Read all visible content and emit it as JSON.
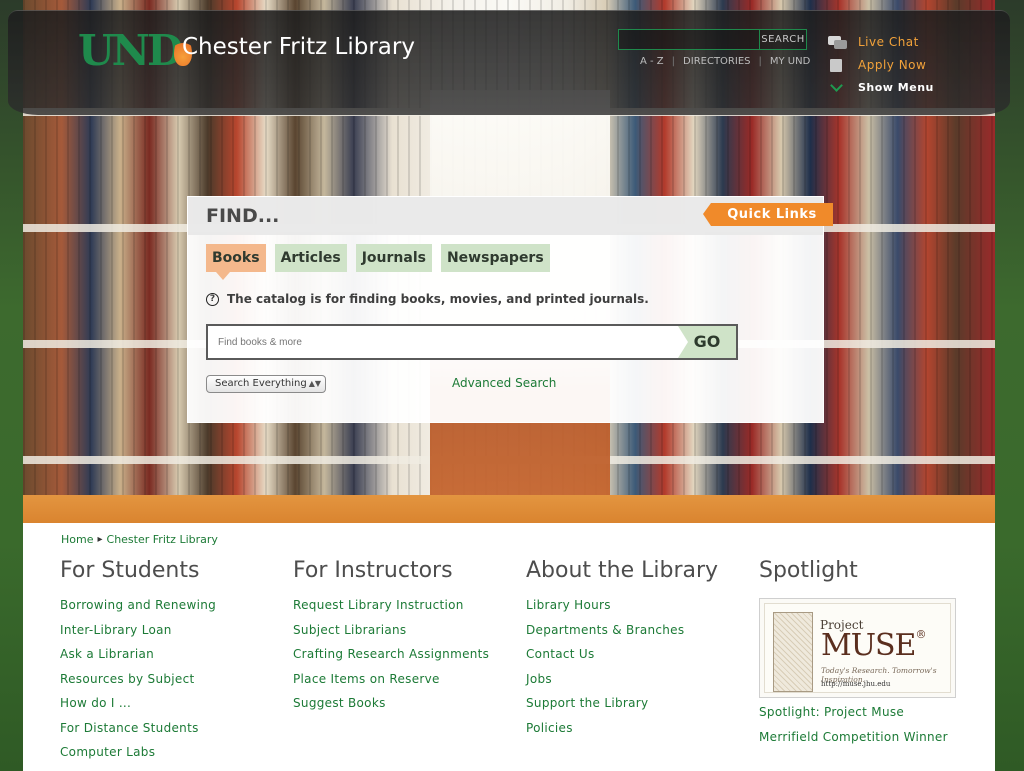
{
  "header": {
    "logo_text": "UND",
    "site_name": "Chester Fritz Library",
    "search": {
      "placeholder": "",
      "button": "SEARCH"
    },
    "utility_links": [
      "A - Z",
      "DIRECTORIES",
      "MY UND"
    ],
    "side_links": [
      {
        "label": "Live Chat",
        "icon": "chat-icon"
      },
      {
        "label": "Apply Now",
        "icon": "apply-icon"
      },
      {
        "label": "Show Menu",
        "icon": "chevron-down-icon"
      }
    ]
  },
  "find": {
    "title": "FIND...",
    "quick_links": "Quick Links",
    "tabs": [
      "Books",
      "Articles",
      "Journals",
      "Newspapers"
    ],
    "active_tab": "Books",
    "help_text": "The catalog is for finding books, movies, and printed journals.",
    "search_placeholder": "Find books & more",
    "go_label": "GO",
    "scope_selected": "Search Everything",
    "advanced_search": "Advanced Search"
  },
  "breadcrumb": [
    "Home",
    "Chester Fritz Library"
  ],
  "columns": [
    {
      "heading": "For Students",
      "links": [
        "Borrowing and Renewing",
        "Inter-Library Loan",
        "Ask a Librarian",
        "Resources by Subject",
        "How do I ...",
        "For Distance Students",
        "Computer Labs"
      ]
    },
    {
      "heading": "For Instructors",
      "links": [
        "Request Library Instruction",
        "Subject Librarians",
        "Crafting Research Assignments",
        "Place Items on Reserve",
        "Suggest Books"
      ]
    },
    {
      "heading": "About the Library",
      "links": [
        "Library Hours",
        "Departments & Branches",
        "Contact Us",
        "Jobs",
        "Support the Library",
        "Policies"
      ]
    },
    {
      "heading": "Spotlight",
      "image": {
        "line1": "Project",
        "line2": "MUSE",
        "reg": "®",
        "tagline": "Today's Research. Tomorrow's Inspiration.",
        "url": "http://muse.jhu.edu"
      },
      "links": [
        "Spotlight: Project Muse",
        "Merrifield Competition Winner"
      ]
    }
  ],
  "colors": {
    "brand_green": "#1c7a36",
    "accent_orange": "#f08a2a",
    "tab_green": "#cfe3c8",
    "tab_active": "#f4b88c"
  }
}
